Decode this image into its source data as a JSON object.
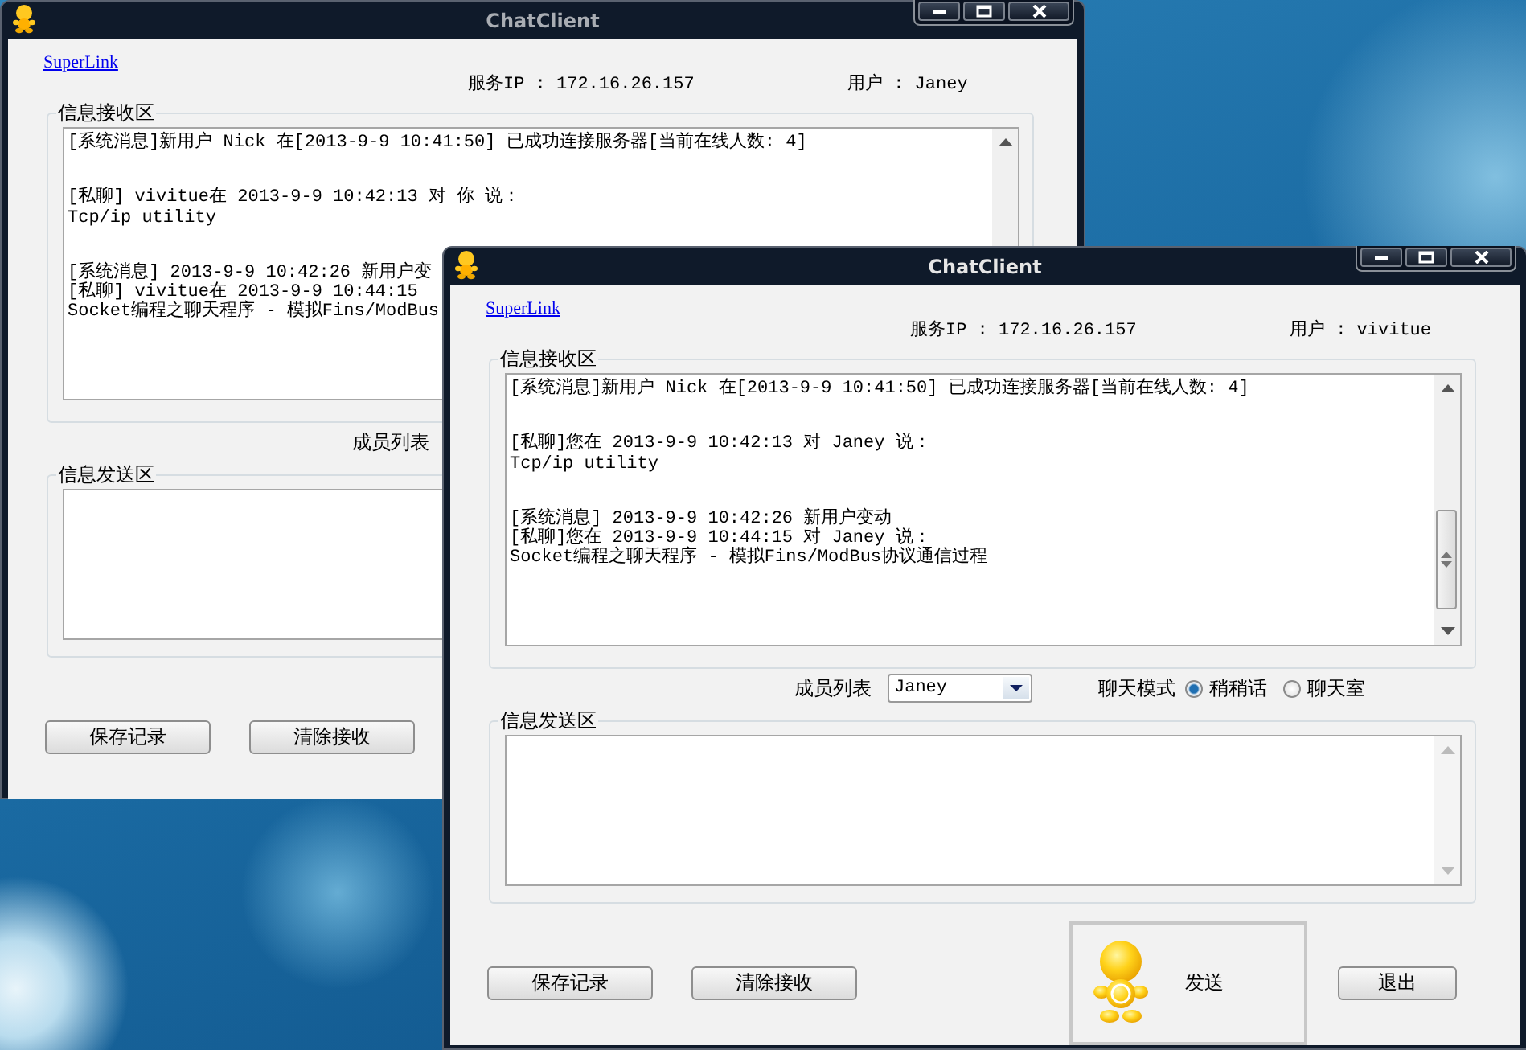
{
  "windows": [
    {
      "title": "ChatClient",
      "active": false,
      "link": "SuperLink",
      "server_ip": "服务IP : 172.16.26.157",
      "user": "用户 : Janey",
      "receive_area": {
        "label": "信息接收区",
        "messages": [
          {
            "lines": [
              "[系统消息]新用户 Nick 在[2013-9-9 10:41:50] 已成功连接服务器[当前在线人数: 4]"
            ]
          },
          {
            "lines": [
              "[私聊] vivitue在 2013-9-9 10:42:13 对 你 说：",
              "Tcp/ip utility"
            ]
          },
          {
            "lines": [
              "[系统消息] 2013-9-9 10:42:26 新用户变",
              "[私聊] vivitue在 2013-9-9 10:44:15",
              "Socket编程之聊天程序 - 模拟Fins/ModBus"
            ]
          }
        ]
      },
      "member_label": "成员列表",
      "send_area": {
        "label": "信息发送区"
      },
      "buttons": [
        "保存记录",
        "清除接收"
      ]
    },
    {
      "title": "ChatClient",
      "active": true,
      "link": "SuperLink",
      "server_ip": "服务IP : 172.16.26.157",
      "user": "用户 : vivitue",
      "receive_area": {
        "label": "信息接收区",
        "messages": [
          {
            "lines": [
              "[系统消息]新用户 Nick 在[2013-9-9 10:41:50] 已成功连接服务器[当前在线人数: 4]"
            ]
          },
          {
            "lines": [
              "[私聊]您在 2013-9-9 10:42:13 对 Janey 说：",
              "Tcp/ip utility"
            ]
          },
          {
            "lines": [
              "[系统消息] 2013-9-9 10:42:26 新用户变动",
              "[私聊]您在 2013-9-9 10:44:15 对 Janey 说：",
              "Socket编程之聊天程序 - 模拟Fins/ModBus协议通信过程"
            ]
          }
        ]
      },
      "member_label": "成员列表",
      "member_select": {
        "value": "Janey"
      },
      "chat_mode": {
        "label": "聊天模式",
        "options": [
          {
            "label": "稍稍话",
            "selected": true
          },
          {
            "label": "聊天室",
            "selected": false
          }
        ]
      },
      "send_area": {
        "label": "信息发送区"
      },
      "buttons": [
        "保存记录",
        "清除接收"
      ],
      "send_button": "发送",
      "exit_button": "退出"
    }
  ]
}
